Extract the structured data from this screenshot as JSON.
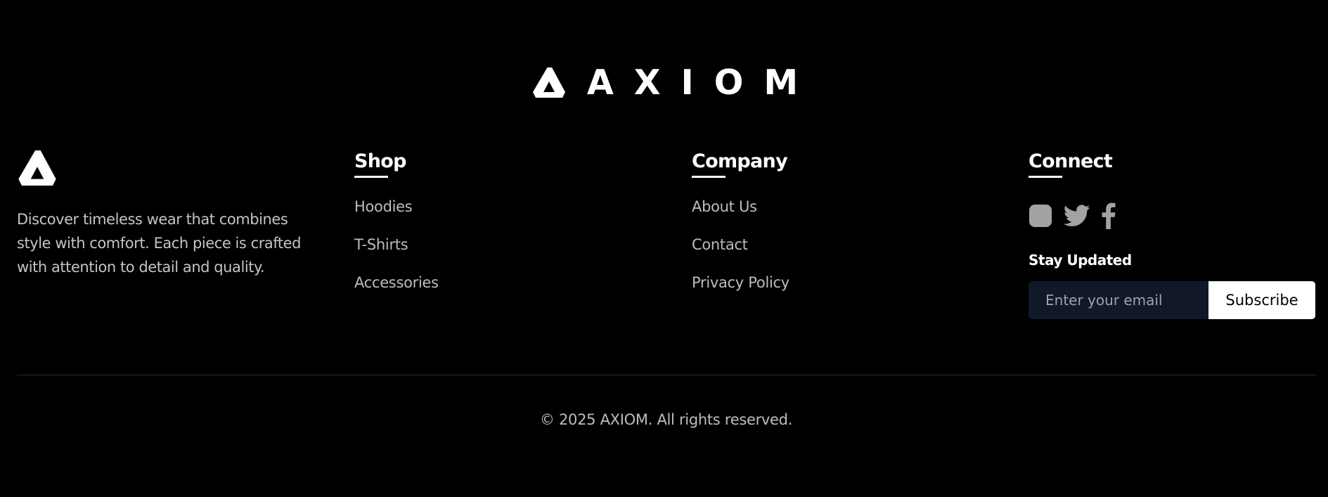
{
  "brand": {
    "name": "AXIOM",
    "description": "Discover timeless wear that combines style with comfort. Each piece is crafted with attention to detail and quality."
  },
  "shop": {
    "heading": "Shop",
    "links": [
      "Hoodies",
      "T-Shirts",
      "Accessories"
    ]
  },
  "company": {
    "heading": "Company",
    "links": [
      "About Us",
      "Contact",
      "Privacy Policy"
    ]
  },
  "connect": {
    "heading": "Connect",
    "social_icons": [
      "instagram-icon",
      "twitter-icon",
      "facebook-icon"
    ],
    "newsletter_title": "Stay Updated",
    "email_placeholder": "Enter your email",
    "subscribe_label": "Subscribe"
  },
  "footer": {
    "copyright": "© 2025 AXIOM. All rights reserved."
  },
  "colors": {
    "background": "#000000",
    "text_primary": "#ffffff",
    "text_muted": "#bdbdbd",
    "icon_muted": "#a3a3a3",
    "input_background": "#111827",
    "divider": "#2a2a2a"
  }
}
